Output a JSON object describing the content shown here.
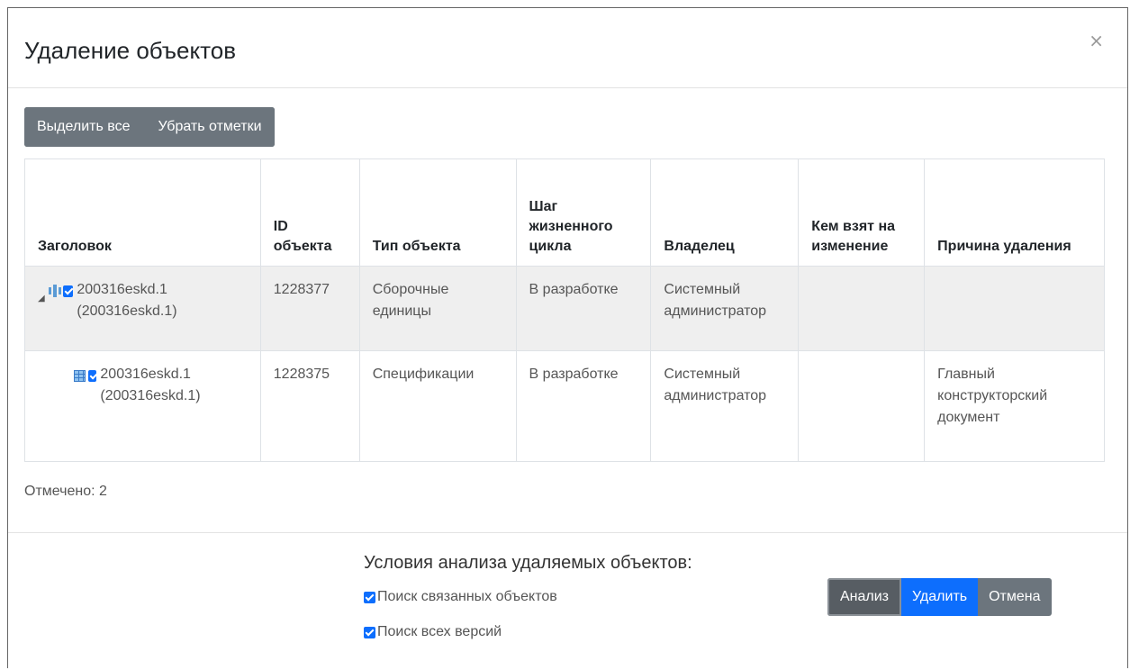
{
  "modal": {
    "title": "Удаление объектов",
    "close_label": "×"
  },
  "toolbar": {
    "select_all_label": "Выделить все",
    "clear_marks_label": "Убрать отметки"
  },
  "table": {
    "headers": {
      "title": "Заголовок",
      "id": "ID объекта",
      "type": "Тип объекта",
      "lifecycle": "Шаг жизненного цикла",
      "owner": "Владелец",
      "taken_by": "Кем взят на изменение",
      "reason": "Причина удаления"
    },
    "rows": [
      {
        "title": "200316eskd.1 (200316eskd.1)",
        "id": "1228377",
        "type": "Сборочные единицы",
        "lifecycle": "В разработке",
        "owner": "Системный администратор",
        "taken_by": "",
        "reason": ""
      },
      {
        "title": "200316eskd.1 (200316eskd.1)",
        "id": "1228375",
        "type": "Спецификации",
        "lifecycle": "В разработке",
        "owner": "Системный администратор",
        "taken_by": "",
        "reason": "Главный конструкторский документ"
      }
    ]
  },
  "checked_count": "Отмечено: 2",
  "conditions": {
    "title": "Условия анализа удаляемых объектов:",
    "option_linked": "Поиск связанных объектов",
    "option_versions": "Поиск всех версий"
  },
  "actions": {
    "analyze_label": "Анализ",
    "delete_label": "Удалить",
    "cancel_label": "Отмена"
  },
  "colors": {
    "primary": "#0d6efd",
    "secondary": "#6c757d",
    "selected_row": "#efefef"
  }
}
